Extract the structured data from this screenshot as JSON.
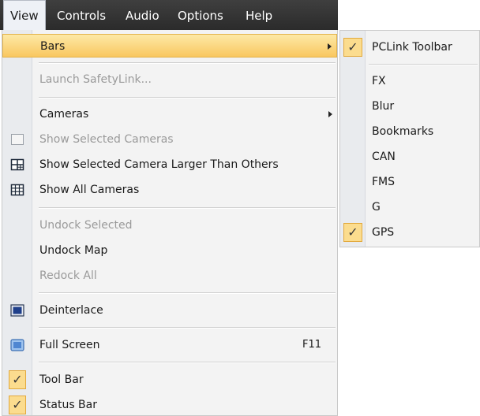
{
  "menubar": {
    "items": [
      {
        "label": "View",
        "active": true
      },
      {
        "label": "Controls"
      },
      {
        "label": "Audio"
      },
      {
        "label": "Options"
      },
      {
        "label": "Help"
      }
    ]
  },
  "view_menu": {
    "items": [
      {
        "label": "Bars",
        "state": "highlighted",
        "submenu": true
      },
      {
        "label": "Launch SafetyLink...",
        "enabled": false
      },
      {
        "label": "Cameras",
        "submenu": true
      },
      {
        "label": "Show Selected Cameras",
        "enabled": false,
        "icon": "single-window-icon"
      },
      {
        "label": "Show Selected Camera Larger Than Others",
        "icon": "large-plus-small-grid-icon"
      },
      {
        "label": "Show All Cameras",
        "icon": "grid-3x3-icon"
      },
      {
        "label": "Undock Selected",
        "enabled": false
      },
      {
        "label": "Undock Map"
      },
      {
        "label": "Redock All",
        "enabled": false
      },
      {
        "label": "Deinterlace",
        "icon": "deinterlace-screen-icon"
      },
      {
        "label": "Full Screen",
        "shortcut": "F11",
        "icon": "full-screen-icon"
      },
      {
        "label": "Tool Bar",
        "checked": true
      },
      {
        "label": "Status Bar",
        "checked": true
      }
    ]
  },
  "bars_submenu": {
    "items": [
      {
        "label": "PCLink Toolbar",
        "checked": true
      },
      {
        "label": "FX"
      },
      {
        "label": "Blur"
      },
      {
        "label": "Bookmarks"
      },
      {
        "label": "CAN"
      },
      {
        "label": "FMS"
      },
      {
        "label": "G"
      },
      {
        "label": "GPS",
        "checked": true
      }
    ]
  },
  "glyphs": {
    "check": "✓"
  },
  "colors": {
    "menubar_bg": "#333333",
    "highlight": "#f9c760",
    "check_bg": "#fbdc8e",
    "disabled_text": "#9a9a9a"
  }
}
